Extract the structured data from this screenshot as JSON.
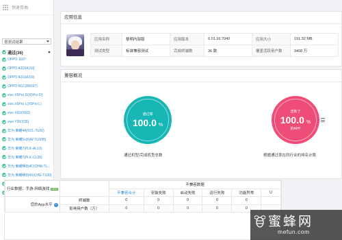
{
  "sidebar": {
    "quick_label": "快速卷曲",
    "select_value": "按测试结果",
    "group_label": "通过(36)",
    "devices": [
      "OPPO 1107",
      "OPPO A31t(A31t)",
      "OPPO A31t(A31t)",
      "OPPO R1C(R8207)",
      "vivo X5Pro D(X5Pro D)",
      "vivo X5Pro L(X5Pro L)",
      "vivo X6D(X6D)",
      "vivo Y35(Y35)",
      "华为 荣耀4A(SCL-TL00)",
      "华为 荣耀5x(KIW-TL00H)",
      "华为 荣耀7(PLK-AL10)",
      "华为 荣耀7(PLK-CL00)",
      "华为 荣耀畅玩4C(CHM-TL...",
      "华为 荣耀畅玩4X(CHE-TL00)",
      "金立 F103(F103)",
      "..."
    ]
  },
  "app_info": {
    "title": "应用信息",
    "rows": [
      [
        "应用名称",
        "黎明内部版",
        "应用版本",
        "0.01.16.7040",
        "应用大小",
        "191.32 MB"
      ],
      [
        "测试类型",
        "标准兼容测试",
        "完成终端数",
        "36 款",
        "覆盖活跃用户数",
        "9408 万"
      ]
    ]
  },
  "compat": {
    "title": "兼容概况",
    "pass_rate": {
      "top": "通过率",
      "value": "100.0",
      "unit": "%",
      "caption": "通过机型/完成机型总数"
    },
    "beat": {
      "top": "击败了",
      "value": "100.0",
      "unit": "%",
      "bottom": "的APP",
      "caption": "根据通过率在同行业的排名计算"
    }
  },
  "stats": {
    "industry_label": "行业数据：手游-网络游戏",
    "new_tag": "NEW",
    "incompat_header": "不兼容数据",
    "columns": [
      "不兼容合计",
      "安装失败",
      "启动失败",
      "运行失败",
      "功能异常",
      "U"
    ],
    "my_level": "您的App水平",
    "qmark": "?",
    "row_labels": [
      "终端数",
      "影响用户数（万）"
    ],
    "row_values": [
      [
        "0",
        "0",
        "0",
        "0",
        "0",
        ""
      ],
      [
        "0",
        "0",
        "0",
        "0",
        "0",
        ""
      ]
    ]
  },
  "watermark": {
    "cn": "蜜蜂网",
    "en": "mefun.com"
  }
}
